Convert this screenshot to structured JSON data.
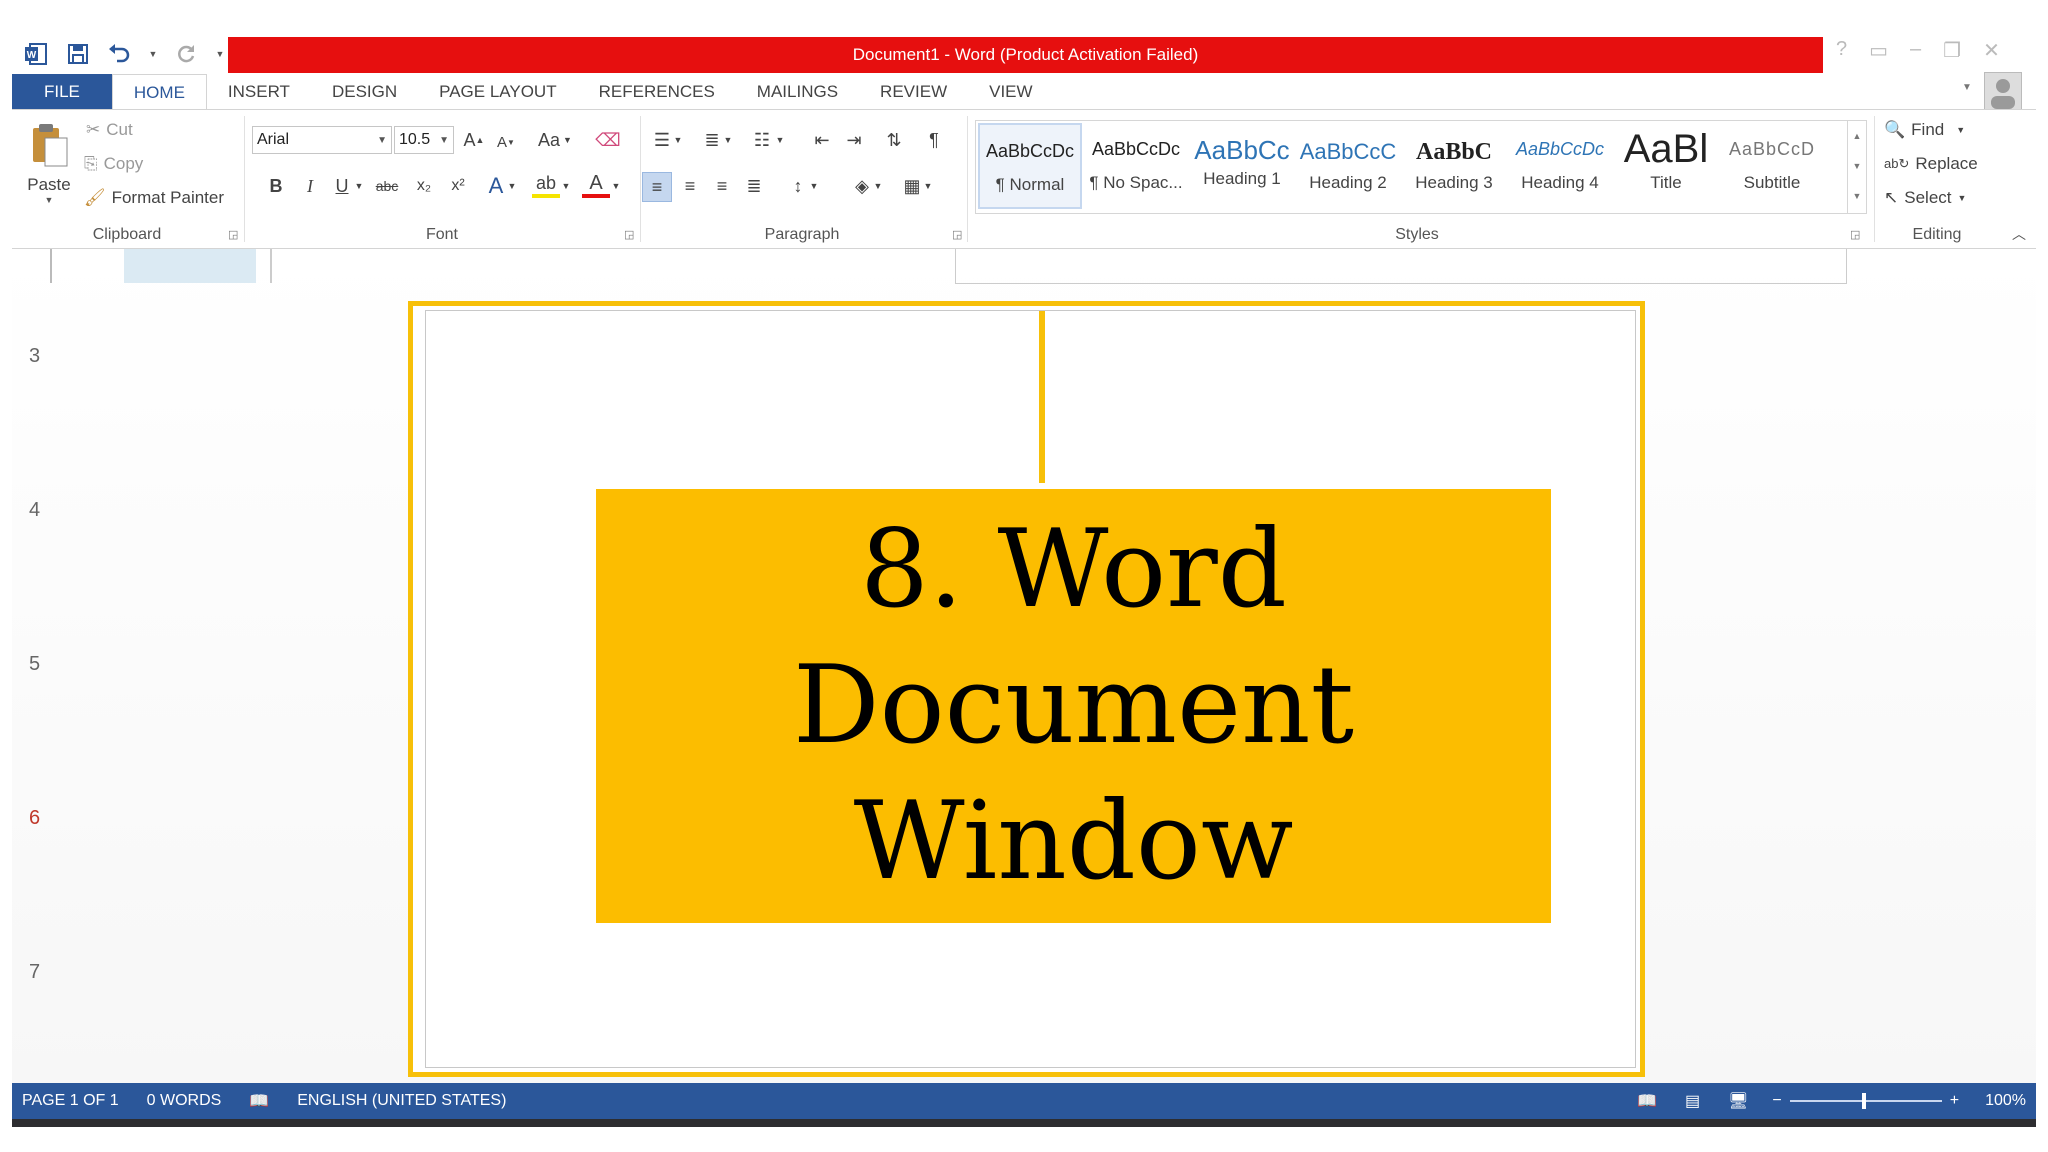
{
  "app": {
    "title": "Document1 -  Word (Product Activation Failed)",
    "colors": {
      "brand": "#2b579a",
      "title_bar": "#e60f0f",
      "accent_yellow": "#f7c009",
      "banner": "#fcbd00"
    }
  },
  "quick_access": {
    "word_icon": "word-logo-icon",
    "save_icon": "save-icon",
    "undo_icon": "undo-icon",
    "redo_icon": "redo-icon",
    "customize_icon": "customize-qat-icon"
  },
  "window_controls": {
    "help": "?",
    "ribbon_options": "ribbon-display-options-icon",
    "minimize": "minimize-icon",
    "restore": "restore-icon",
    "close": "close-icon"
  },
  "tabs": [
    "FILE",
    "HOME",
    "INSERT",
    "DESIGN",
    "PAGE LAYOUT",
    "REFERENCES",
    "MAILINGS",
    "REVIEW",
    "VIEW"
  ],
  "ribbon": {
    "clipboard": {
      "label": "Clipboard",
      "paste": "Paste",
      "cut": "Cut",
      "copy": "Copy",
      "format_painter": "Format Painter"
    },
    "font": {
      "label": "Font",
      "font_name": "Arial",
      "font_size": "10.5",
      "change_case": "Aa",
      "bold": "B",
      "italic": "I",
      "underline": "U",
      "strikethrough": "abc",
      "subscript": "x₂",
      "superscript": "x²"
    },
    "paragraph": {
      "label": "Paragraph"
    },
    "styles": {
      "label": "Styles",
      "items": [
        {
          "sample": "AaBbCcDc",
          "name": "¶ Normal"
        },
        {
          "sample": "AaBbCcDc",
          "name": "¶ No Spac..."
        },
        {
          "sample": "AaBbCc",
          "name": "Heading 1"
        },
        {
          "sample": "AaBbCcC",
          "name": "Heading 2"
        },
        {
          "sample": "AaBbC",
          "name": "Heading 3"
        },
        {
          "sample": "AaBbCcDc",
          "name": "Heading 4"
        },
        {
          "sample": "AaBl",
          "name": "Title"
        },
        {
          "sample": "AaBbCcD",
          "name": "Subtitle"
        }
      ]
    },
    "editing": {
      "label": "Editing",
      "find": "Find",
      "replace": "Replace",
      "select": "Select"
    }
  },
  "slides": {
    "numbers": [
      "3",
      "4",
      "5",
      "6",
      "7"
    ],
    "active": "6"
  },
  "document": {
    "banner_text": "8. Word\nDocument\nWindow"
  },
  "status": {
    "page": "PAGE 1 OF 1",
    "words": "0 WORDS",
    "language": "ENGLISH (UNITED STATES)",
    "zoom": "100%"
  }
}
